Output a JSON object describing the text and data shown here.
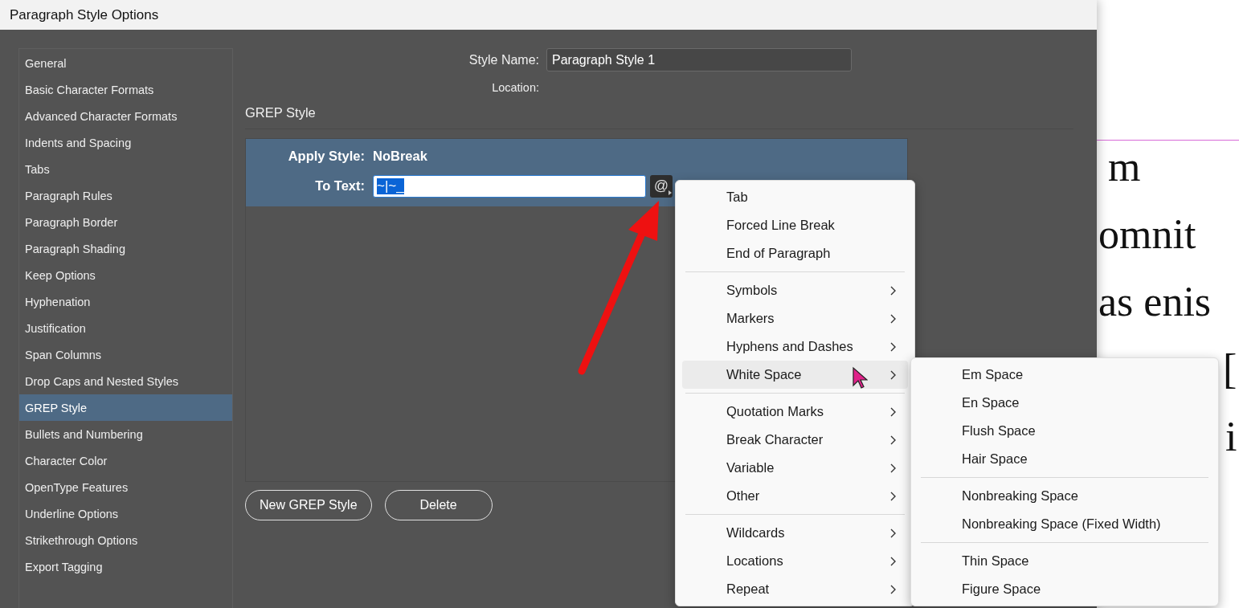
{
  "window": {
    "title": "Paragraph Style Options"
  },
  "sidebar": {
    "items": [
      {
        "label": "General",
        "selected": false
      },
      {
        "label": "Basic Character Formats",
        "selected": false
      },
      {
        "label": "Advanced Character Formats",
        "selected": false
      },
      {
        "label": "Indents and Spacing",
        "selected": false
      },
      {
        "label": "Tabs",
        "selected": false
      },
      {
        "label": "Paragraph Rules",
        "selected": false
      },
      {
        "label": "Paragraph Border",
        "selected": false
      },
      {
        "label": "Paragraph Shading",
        "selected": false
      },
      {
        "label": "Keep Options",
        "selected": false
      },
      {
        "label": "Hyphenation",
        "selected": false
      },
      {
        "label": "Justification",
        "selected": false
      },
      {
        "label": "Span Columns",
        "selected": false
      },
      {
        "label": "Drop Caps and Nested Styles",
        "selected": false
      },
      {
        "label": "GREP Style",
        "selected": true
      },
      {
        "label": "Bullets and Numbering",
        "selected": false
      },
      {
        "label": "Character Color",
        "selected": false
      },
      {
        "label": "OpenType Features",
        "selected": false
      },
      {
        "label": "Underline Options",
        "selected": false
      },
      {
        "label": "Strikethrough Options",
        "selected": false
      },
      {
        "label": "Export Tagging",
        "selected": false
      }
    ]
  },
  "style_name": {
    "label": "Style Name:",
    "value": "Paragraph Style 1"
  },
  "location": {
    "label": "Location:"
  },
  "section_title": "GREP Style",
  "grep_rules": [
    {
      "selected": true,
      "apply_label": "Apply Style:",
      "apply_value": "NoBreak",
      "text_label": "To Text:",
      "text_value": "~|~_",
      "text_selected": true
    }
  ],
  "special_char_button": {
    "label": "@"
  },
  "buttons": [
    "New GREP Style",
    "Delete"
  ],
  "menu": {
    "groups": [
      [
        {
          "label": "Tab",
          "submenu": false,
          "selected": false
        },
        {
          "label": "Forced Line Break",
          "submenu": false,
          "selected": false
        },
        {
          "label": "End of Paragraph",
          "submenu": false,
          "selected": false
        }
      ],
      [
        {
          "label": "Symbols",
          "submenu": true,
          "selected": false
        },
        {
          "label": "Markers",
          "submenu": true,
          "selected": false
        },
        {
          "label": "Hyphens and Dashes",
          "submenu": true,
          "selected": false
        },
        {
          "label": "White Space",
          "submenu": true,
          "selected": true
        }
      ],
      [
        {
          "label": "Quotation Marks",
          "submenu": true,
          "selected": false
        },
        {
          "label": "Break Character",
          "submenu": true,
          "selected": false
        },
        {
          "label": "Variable",
          "submenu": true,
          "selected": false
        },
        {
          "label": "Other",
          "submenu": true,
          "selected": false
        }
      ],
      [
        {
          "label": "Wildcards",
          "submenu": true,
          "selected": false
        },
        {
          "label": "Locations",
          "submenu": true,
          "selected": false
        },
        {
          "label": "Repeat",
          "submenu": true,
          "selected": false
        }
      ]
    ]
  },
  "submenu": {
    "groups": [
      [
        {
          "label": "Em Space"
        },
        {
          "label": "En Space"
        },
        {
          "label": "Flush Space"
        },
        {
          "label": "Hair Space"
        }
      ],
      [
        {
          "label": "Nonbreaking Space"
        },
        {
          "label": "Nonbreaking Space (Fixed Width)"
        }
      ],
      [
        {
          "label": "Thin Space"
        },
        {
          "label": "Figure Space"
        }
      ]
    ]
  },
  "document": {
    "lines": [
      "m",
      "omnit",
      "as enis",
      "[",
      "i"
    ]
  }
}
